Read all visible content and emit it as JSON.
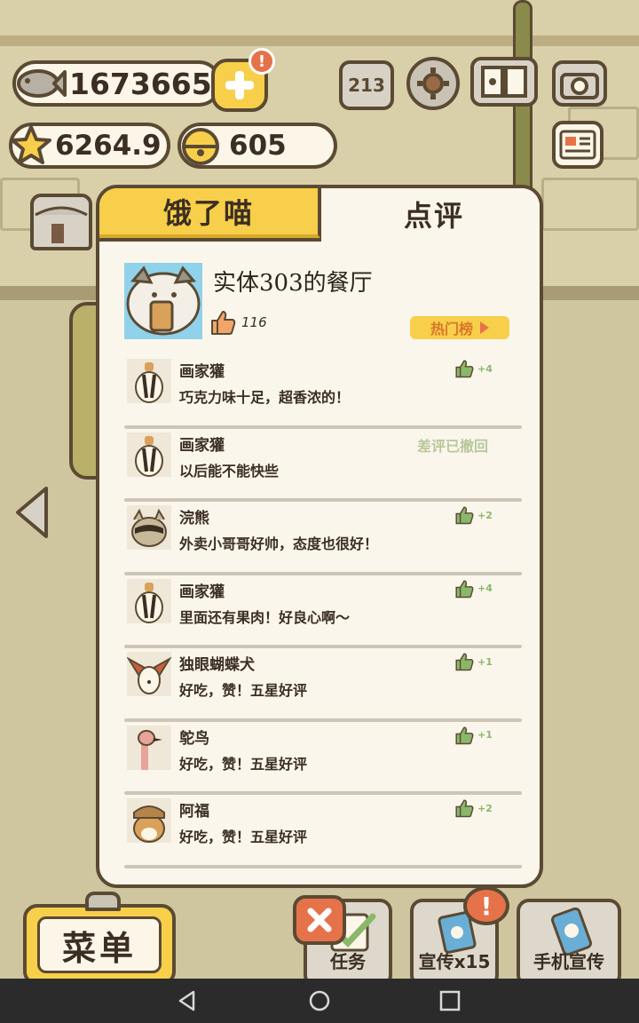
{
  "hud": {
    "fish": "1673665",
    "stars": "6264.9",
    "bells": "605",
    "plus_alert": "!",
    "rank_icon_text": "213"
  },
  "modal": {
    "tabs": [
      {
        "label": "饿了喵",
        "active": false
      },
      {
        "label": "点评",
        "active": true
      }
    ],
    "restaurant": {
      "name": "实体303的餐厅",
      "likes": "116",
      "hot_button": "热门榜"
    },
    "reviews": [
      {
        "name": "画家獾",
        "text": "巧克力味十足，超香浓的！",
        "likes": "+4",
        "avatar": "badger"
      },
      {
        "name": "画家獾",
        "text": "以后能不能快些",
        "status": "差评已撤回",
        "avatar": "badger"
      },
      {
        "name": "浣熊",
        "text": "外卖小哥哥好帅，态度也很好！",
        "likes": "+2",
        "avatar": "raccoon"
      },
      {
        "name": "画家獾",
        "text": "里面还有果肉！好良心啊～",
        "likes": "+4",
        "avatar": "badger"
      },
      {
        "name": "独眼蝴蝶犬",
        "text": "好吃，赞！五星好评",
        "likes": "+1",
        "avatar": "papillon"
      },
      {
        "name": "鸵鸟",
        "text": "好吃，赞！五星好评",
        "likes": "+1",
        "avatar": "ostrich"
      },
      {
        "name": "阿福",
        "text": "好吃，赞！五星好评",
        "likes": "+2",
        "avatar": "afu"
      }
    ]
  },
  "bottom": {
    "menu_label": "菜单",
    "tasks_label": "任务",
    "promo_label": "宣传x15",
    "phone_promo_label": "手机宣传",
    "alert": "!"
  },
  "colors": {
    "accent": "#f8cf4a",
    "outline": "#5b4a33",
    "panel": "#fbf6ec",
    "like_green": "#8ab86a",
    "alert": "#e6724a"
  }
}
